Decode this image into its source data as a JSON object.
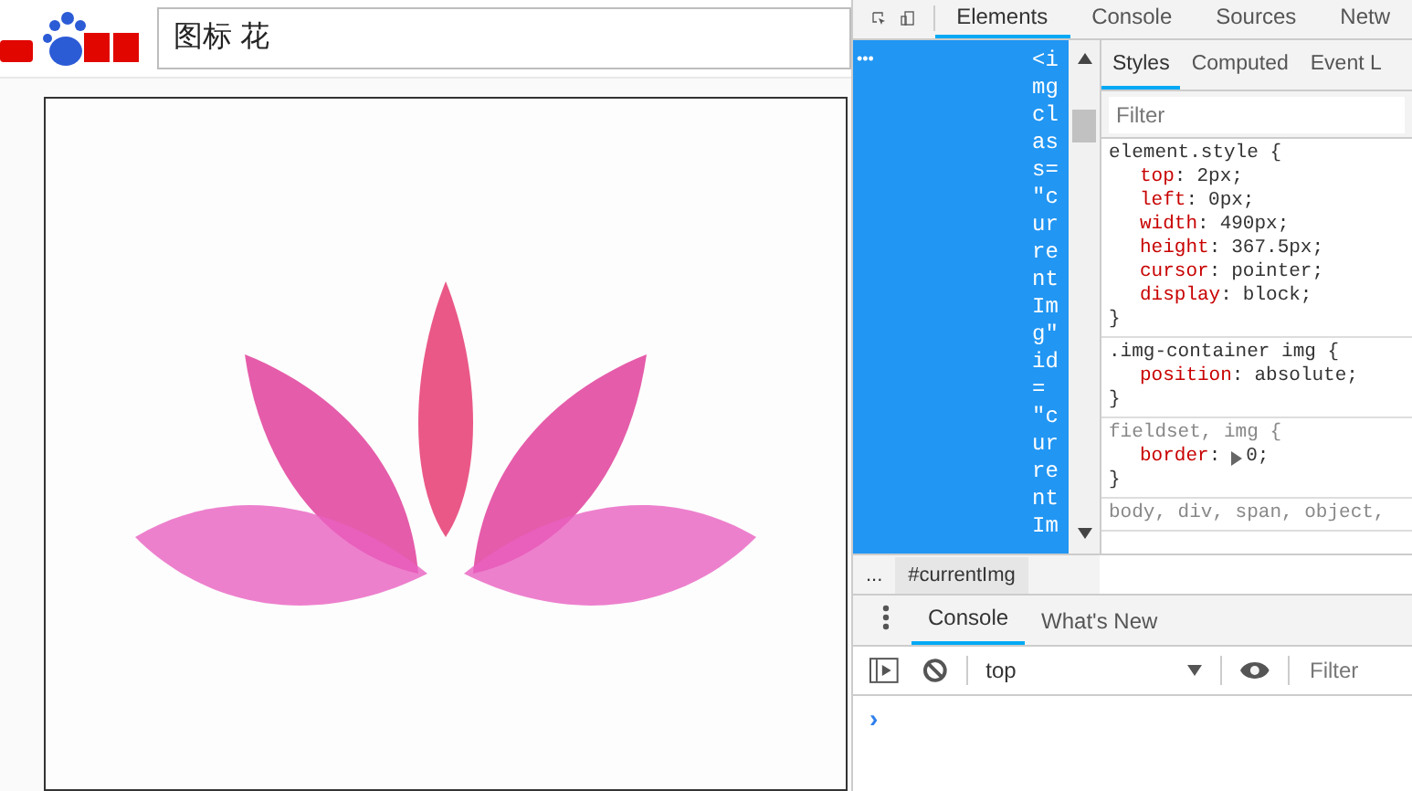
{
  "page": {
    "search": {
      "value": "图标 花"
    }
  },
  "devtools": {
    "tabs": [
      {
        "label": "Elements",
        "selected": true
      },
      {
        "label": "Console",
        "selected": false
      },
      {
        "label": "Sources",
        "selected": false
      },
      {
        "label": "Netw",
        "selected": false
      }
    ],
    "dom_ellipsis": "•••",
    "dom_node_lines": [
      "<i",
      "mg",
      "cl",
      "as",
      "s=",
      "\"c",
      "ur",
      "re",
      "nt",
      "Im",
      "g\"",
      "id",
      "=",
      "\"c",
      "ur",
      "re",
      "nt",
      "Im"
    ],
    "breadcrumb": [
      {
        "label": "...",
        "selected": false
      },
      {
        "label": "#currentImg",
        "selected": true
      }
    ],
    "styles_tabs": [
      {
        "label": "Styles",
        "selected": true
      },
      {
        "label": "Computed",
        "selected": false
      },
      {
        "label": "Event L",
        "selected": false
      }
    ],
    "colon": ":",
    "styles_filter": {
      "placeholder": "Filter"
    },
    "rules": [
      {
        "selector": "element.style {",
        "inherited": false,
        "props": [
          {
            "name": "top",
            "value": "2px;",
            "expandable": false
          },
          {
            "name": "left",
            "value": "0px;",
            "expandable": false
          },
          {
            "name": "width",
            "value": "490px;",
            "expandable": false
          },
          {
            "name": "height",
            "value": "367.5px;",
            "expandable": false
          },
          {
            "name": "cursor",
            "value": "pointer;",
            "expandable": false
          },
          {
            "name": "display",
            "value": "block;",
            "expandable": false
          }
        ],
        "close": "}"
      },
      {
        "selector": ".img-container img {",
        "inherited": false,
        "props": [
          {
            "name": "position",
            "value": "absolute;",
            "expandable": false
          }
        ],
        "close": "}"
      },
      {
        "selector": "fieldset, img {",
        "inherited": true,
        "props": [
          {
            "name": "border",
            "value": "0;",
            "expandable": true
          }
        ],
        "close": "}"
      },
      {
        "selector": "body, div, span, object,",
        "inherited": true
      }
    ],
    "drawer_tabs": [
      {
        "label": "Console",
        "selected": true
      },
      {
        "label": "What's New",
        "selected": false
      }
    ],
    "context": "top",
    "console_filter": {
      "placeholder": "Filter"
    },
    "prompt": "›"
  }
}
